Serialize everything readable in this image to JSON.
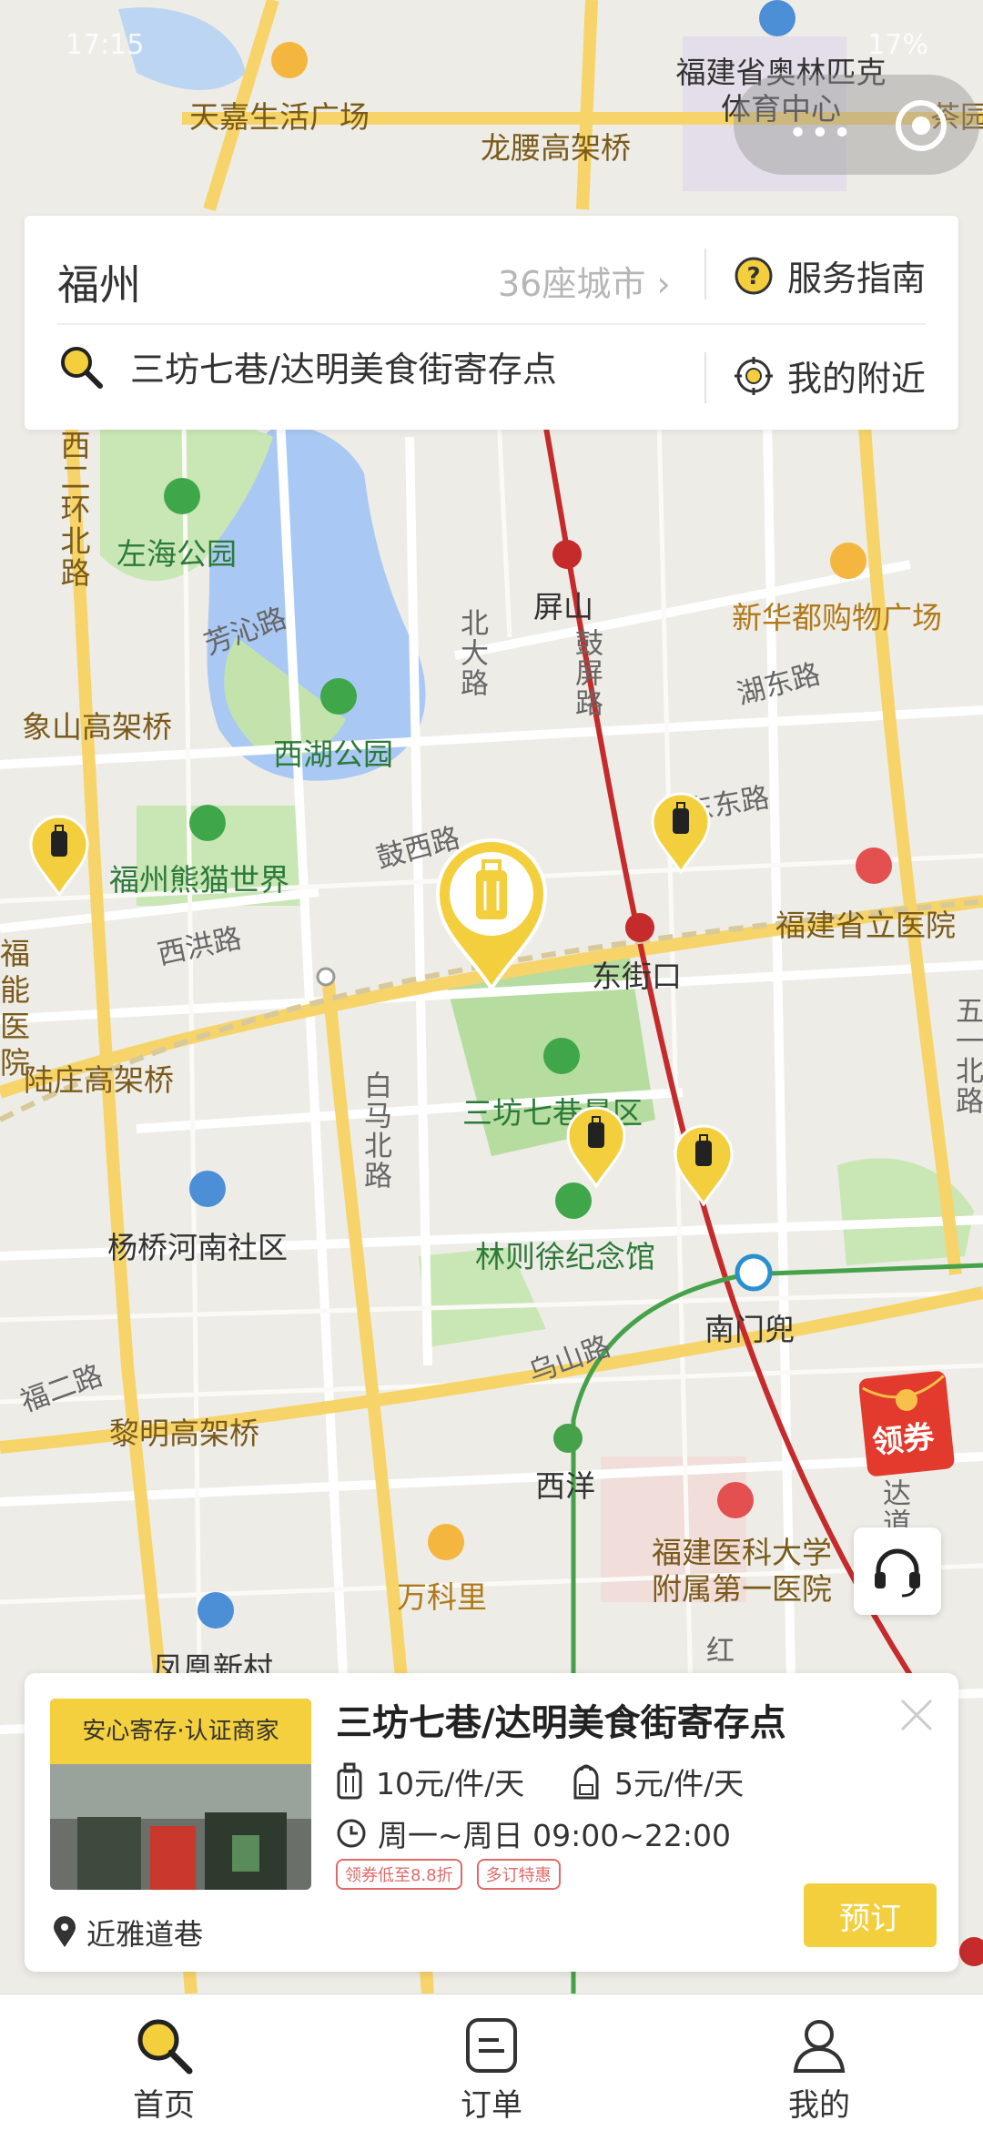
{
  "status_bar": {
    "time": "17:15",
    "battery": "17%"
  },
  "map_labels": {
    "tianjia": "天嘉生活广场",
    "olympic": "福建省奥林匹克体育中心",
    "chayuan": "茶园",
    "longteng": "龙腰高架桥",
    "xihuan_north": "西二环北路",
    "zuohai": "左海公园",
    "fangqin": "芳沁路",
    "pingshan": "屏山",
    "xinhuadu": "新华都购物广场",
    "beidalu": "北大路",
    "gupinglu": "鼓屏路",
    "hudonglu": "湖东路",
    "xiangshan": "象山高架桥",
    "xihu": "西湖公园",
    "panda": "福州熊猫世界",
    "guxilu": "鼓西路",
    "dongdonglu": "东东路",
    "provincial_hosp": "福建省立医院",
    "xihonglu": "西洪路",
    "fuhosp": "福能医院",
    "dongjiekou": "东街口",
    "luzhuang": "陆庄高架桥",
    "baimabei": "白马北路",
    "sanfang": "三坊七巷景区",
    "wuyi": "五一北路",
    "yangqiao": "杨桥河南社区",
    "linzexu": "林则徐纪念馆",
    "nanmendou": "南门兜",
    "fuer": "福二路",
    "wushan": "乌山路",
    "liming": "黎明高架桥",
    "xiyang": "西洋",
    "daolu": "达道路",
    "medical_univ": "福建医科大学附属第一医院",
    "wankeli": "万科里",
    "fenghuang": "凤凰新村",
    "hong": "红"
  },
  "header": {
    "city": "福州",
    "city_count": "36座城市",
    "service_guide": "服务指南",
    "search_text": "三坊七巷/达明美食街寄存点",
    "nearby": "我的附近"
  },
  "red_packet_label": "领券",
  "store": {
    "badge": "安心寄存·认证商家",
    "name": "三坊七巷/达明美食街寄存点",
    "price_large": "10元/件/天",
    "price_small": "5元/件/天",
    "hours": "周一~周日 09:00~22:00",
    "tags": [
      "领券低至8.8折",
      "多订特惠"
    ],
    "address": "近雅道巷",
    "book_label": "预订"
  },
  "tabs": [
    {
      "label": "首页",
      "icon": "search-icon"
    },
    {
      "label": "订单",
      "icon": "order-icon"
    },
    {
      "label": "我的",
      "icon": "user-icon"
    }
  ],
  "colors": {
    "accent": "#f4cf3e",
    "text": "#333333",
    "tag": "#e06a6a"
  }
}
